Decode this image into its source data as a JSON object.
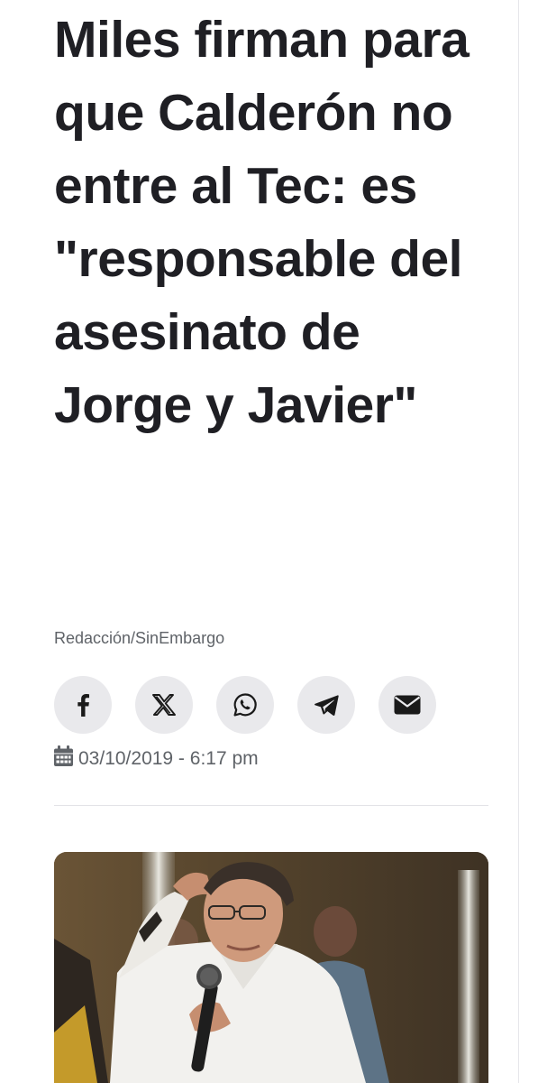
{
  "article": {
    "headline": "Miles firman para que Calderón no entre al Tec: es \"responsable del asesinato de Jorge y Javier\"",
    "byline": "Redacción/SinEmbargo",
    "date": "03/10/2019 - 6:17 pm"
  },
  "share": {
    "buttons": [
      {
        "network": "facebook",
        "icon": "facebook-icon"
      },
      {
        "network": "x",
        "icon": "x-icon"
      },
      {
        "network": "whatsapp",
        "icon": "whatsapp-icon"
      },
      {
        "network": "telegram",
        "icon": "telegram-icon"
      },
      {
        "network": "email",
        "icon": "envelope-icon"
      }
    ]
  },
  "colors": {
    "headline": "#1f1f24",
    "meta_text": "#5f6368",
    "share_bg": "#e9e9ec",
    "icon": "#1a1a1a"
  }
}
